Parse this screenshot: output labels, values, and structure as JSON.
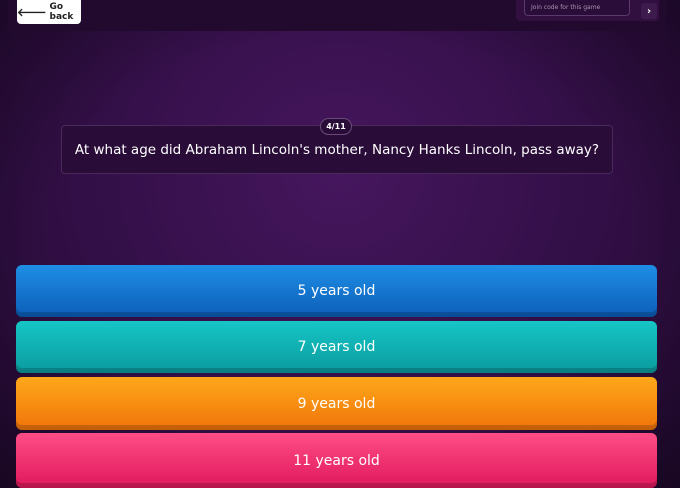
{
  "topbar": {
    "back_label": "Go back",
    "join_placeholder": "Join code for this game"
  },
  "question": {
    "counter": "4/11",
    "text": "At what age did Abraham Lincoln's mother, Nancy Hanks Lincoln, pass away?"
  },
  "options": [
    {
      "label": "5 years old",
      "color": "#1976d2"
    },
    {
      "label": "7 years old",
      "color": "#12b0b3"
    },
    {
      "label": "9 years old",
      "color": "#fb8c12"
    },
    {
      "label": "11 years old",
      "color": "#f23371"
    }
  ]
}
